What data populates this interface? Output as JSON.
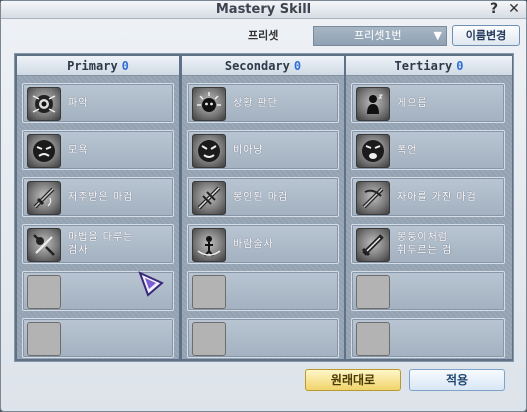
{
  "window": {
    "title": "Mastery Skill",
    "help_label": "?",
    "close_label": "✕"
  },
  "preset": {
    "label": "프리셋",
    "selected": "프리셋1번",
    "rename_label": "이름변경"
  },
  "columns": [
    {
      "title": "Primary",
      "count": "0",
      "slots": [
        {
          "label": "파악",
          "icon": "eye-icon"
        },
        {
          "label": "모욕",
          "icon": "angry-face-icon"
        },
        {
          "label": "저주받은 마검",
          "icon": "cursed-sword-icon"
        },
        {
          "label": "마법을 다루는\n검사",
          "icon": "magic-swordsman-icon"
        },
        {
          "label": "",
          "icon": "empty-slot"
        },
        {
          "label": "",
          "icon": "empty-slot"
        }
      ]
    },
    {
      "title": "Secondary",
      "count": "0",
      "slots": [
        {
          "label": "상황 판단",
          "icon": "aura-figure-icon"
        },
        {
          "label": "비아냥",
          "icon": "mocking-face-icon"
        },
        {
          "label": "봉인된 마검",
          "icon": "sealed-sword-icon"
        },
        {
          "label": "바람술사",
          "icon": "wind-mage-icon"
        },
        {
          "label": "",
          "icon": "empty-slot"
        },
        {
          "label": "",
          "icon": "empty-slot"
        }
      ]
    },
    {
      "title": "Tertiary",
      "count": "0",
      "slots": [
        {
          "label": "게으름",
          "icon": "lazy-figure-icon"
        },
        {
          "label": "폭언",
          "icon": "shouting-face-icon"
        },
        {
          "label": "자아를 가진 마검",
          "icon": "sentient-sword-icon"
        },
        {
          "label": "몽둥이처럼\n휘두르는 검",
          "icon": "club-sword-icon"
        },
        {
          "label": "",
          "icon": "empty-slot"
        },
        {
          "label": "",
          "icon": "empty-slot"
        }
      ]
    }
  ],
  "buttons": {
    "reset_label": "원래대로",
    "apply_label": "적용"
  },
  "colors": {
    "accent_count": "#2f6fd8",
    "panel_bg": "#5f7186",
    "reset_button": "#f0d36b"
  }
}
